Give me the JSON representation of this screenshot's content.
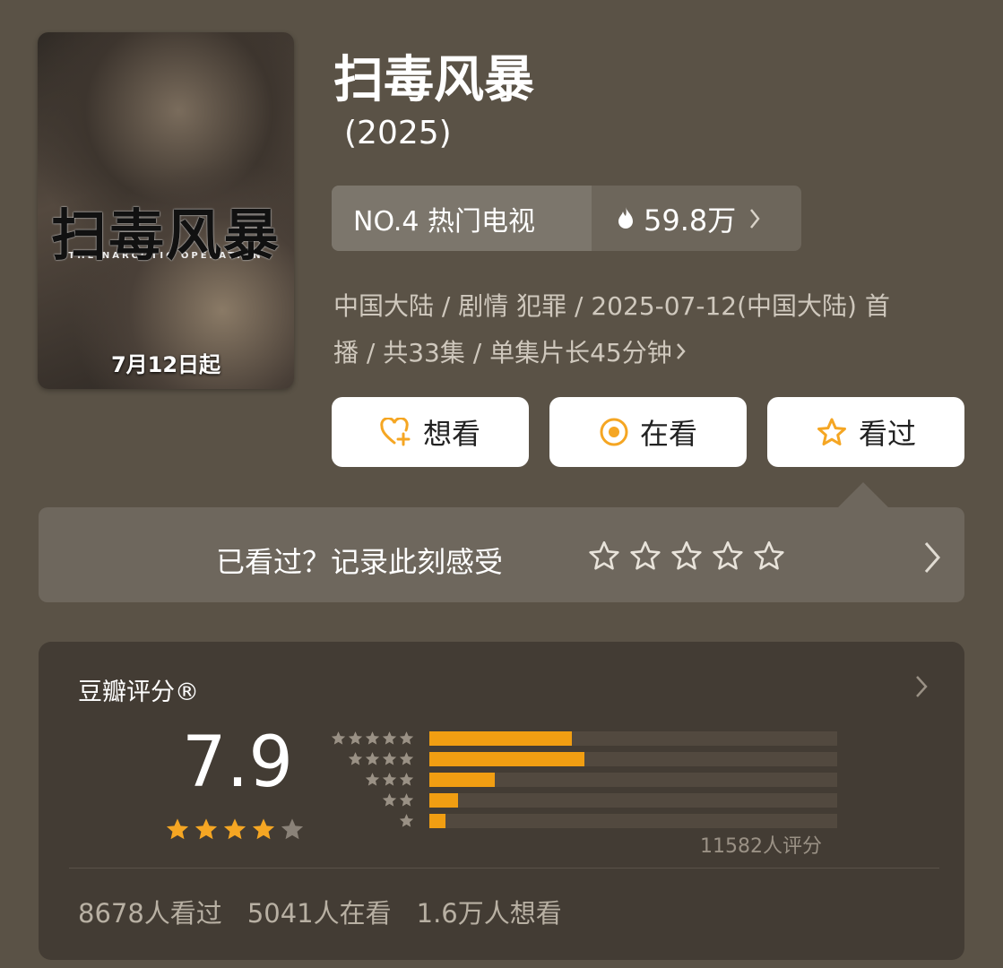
{
  "poster": {
    "title_text": "扫毒风暴",
    "subtitle_text": "THE NARCOTIC OPERATION",
    "date_text": "7月12日起"
  },
  "show": {
    "title": "扫毒风暴",
    "year": "(2025)"
  },
  "rank": {
    "label": "NO.4 热门电视",
    "heat": "59.8万",
    "icon": "flame-icon"
  },
  "meta": {
    "line1": "中国大陆 / 剧情 犯罪 / 2025-07-12(中国大陆) 首",
    "line2": "播 / 共33集 / 单集片长45分钟"
  },
  "actions": {
    "want": "想看",
    "watching": "在看",
    "watched": "看过",
    "accent": "#f5a623"
  },
  "record": {
    "prompt": "已看过？记录此刻感受",
    "star_count": 5
  },
  "rating": {
    "label": "豆瓣评分®",
    "score": "7.9",
    "stars_filled": 4,
    "stars_total": 5,
    "distribution": [
      {
        "stars": 5,
        "fraction": 0.35
      },
      {
        "stars": 4,
        "fraction": 0.38
      },
      {
        "stars": 3,
        "fraction": 0.16
      },
      {
        "stars": 2,
        "fraction": 0.07
      },
      {
        "stars": 1,
        "fraction": 0.04
      }
    ],
    "count_text": "11582人评分",
    "bar_color": "#f19e12"
  },
  "stats": {
    "watched": "8678人看过",
    "watching": "5041人在看",
    "want": "1.6万人想看"
  }
}
